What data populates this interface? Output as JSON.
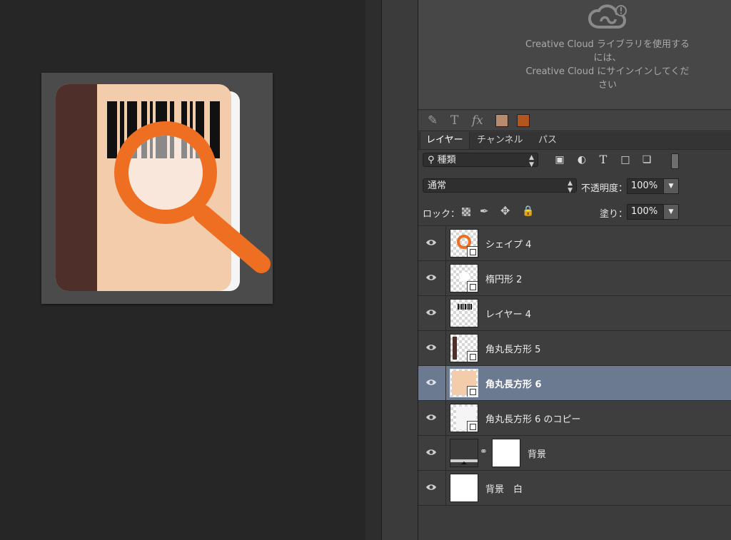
{
  "canvas": {
    "colors": {
      "artboard_bg": "#4b4b4b",
      "spine": "#4e2f29",
      "page": "#f3ccab",
      "back_page": "#f5f5f5",
      "magnifier": "#ee6e22",
      "lens": "#f9e7dc"
    }
  },
  "cc_library": {
    "message_line1": "Creative Cloud ライブラリを使用する",
    "message_line2": "には、",
    "message_line3": "Creative Cloud にサインインしてくだ",
    "message_line4": "さい",
    "logo_icon": "creative-cloud-logo-icon"
  },
  "style_bar": {
    "icons": [
      "paint-style-icon",
      "text-style-icon",
      "fx-icon"
    ],
    "text_icon_glyph": "T",
    "fx_icon_glyph": "fx",
    "swatch_1": "#b88a6e",
    "swatch_2": "#b4551e"
  },
  "tabs": [
    {
      "label": "レイヤー",
      "active": true
    },
    {
      "label": "チャンネル",
      "active": false
    },
    {
      "label": "パス",
      "active": false
    }
  ],
  "filter": {
    "kind_label": "種類",
    "icons": [
      "image-filter-icon",
      "adjustment-filter-icon",
      "text-filter-icon",
      "shape-filter-icon",
      "smartobject-filter-icon",
      "filter-toggle-icon"
    ],
    "text_glyph": "T"
  },
  "blend": {
    "mode": "通常",
    "opacity_label": "不透明度：",
    "opacity_value": "100%"
  },
  "lock": {
    "label": "ロック：",
    "icons": [
      "lock-transparent-icon",
      "lock-image-icon",
      "lock-position-icon",
      "lock-all-icon"
    ],
    "fill_label": "塗り：",
    "fill_value": "100%"
  },
  "layers": [
    {
      "name": "シェイプ 4",
      "selected": false,
      "thumb": "orange-ring"
    },
    {
      "name": "楕円形 2",
      "selected": false,
      "thumb": "white-circle"
    },
    {
      "name": "レイヤー 4",
      "selected": false,
      "thumb": "barcode"
    },
    {
      "name": "角丸長方形 5",
      "selected": false,
      "thumb": "brown-bar"
    },
    {
      "name": "角丸長方形 6",
      "selected": true,
      "thumb": "peach-rect"
    },
    {
      "name": "角丸長方形 6 のコピー",
      "selected": false,
      "thumb": "white-rect"
    },
    {
      "name": "背景",
      "selected": false,
      "thumb": "dark-fill",
      "has_mask": true
    },
    {
      "name": "背景　白",
      "selected": false,
      "thumb": "white"
    }
  ]
}
